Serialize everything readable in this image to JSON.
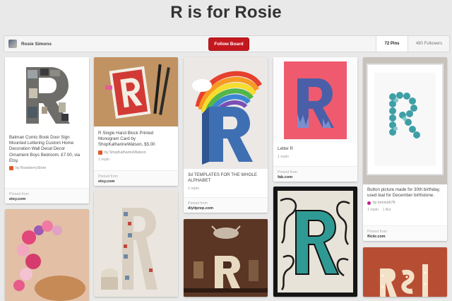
{
  "board": {
    "title": "R is for Rosie",
    "owner": "Rosie Simons",
    "follow_label": "Follow Board",
    "pins_count": "72 Pins",
    "followers_count": "490 Followers"
  },
  "pins": [
    {
      "description": "Batman Comic Book Door Sign Mounted Lettering Custom Home Decoration Wall Decal Decor Ornament Boys Bedroom. £7.00, via Etsy.",
      "by": "by RoseberryStore",
      "pinned_from": "Pinned from",
      "domain": "etsy.com"
    },
    {
      "description": "R Single Hand Block Printed Monogram Card by ShopKatharineWatson, $5.00",
      "by": "by ShopKatharineWatson",
      "repins": "1 repin",
      "pinned_from": "Pinned from",
      "domain": "etsy.com"
    },
    {
      "description": "3d TEMPLATES FOR THE WHOLE ALPHABET",
      "repins": "1 repin",
      "pinned_from": "Pinned from",
      "domain": "diyitprep.com"
    },
    {
      "description": "Letter R",
      "repins": "1 repin",
      "pinned_from": "Pinned from",
      "domain": "fab.com"
    },
    {
      "description": "Button picture made for 30th birthday, used teal for December birthstone.",
      "by": "by tomiruth78",
      "repins": "1 repin",
      "likes": "1 like",
      "pinned_from": "Pinned from",
      "domain": "flickr.com"
    }
  ]
}
